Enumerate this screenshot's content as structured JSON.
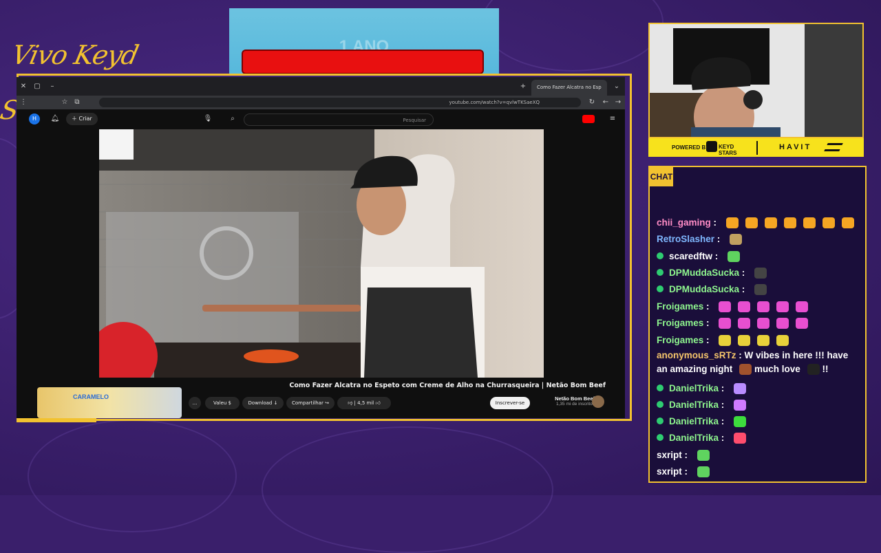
{
  "overlay": {
    "logo_text": "Vivo Keyd Stars",
    "banner_ghost_text": "1 ANO",
    "sponsor_prefix": "POWERED BY",
    "sponsor_brand_1": "KEYD STARS",
    "sponsor_brand_2": "HAVIT",
    "chat_header": "CHAT",
    "colors": {
      "gold": "#f2c230",
      "purple_bg": "#3a1f6b",
      "chat_bg": "#1a0e3a",
      "banner_red": "#e81010"
    }
  },
  "browser": {
    "tab_title": "Como Fazer Alcatra no Esp",
    "url": "youtube.com/watch?v=qvlwTKSaeXQ",
    "youtube": {
      "search_placeholder": "Pesquisar",
      "create_label": "Criar",
      "video_title": "Como Fazer Alcatra no Espeto com Creme de Alho na Churrasqueira | Netão Bom Beef",
      "channel_name": "Netão Bom Beef",
      "subscribers": "1,35 mi de inscritos",
      "subscribe_label": "Inscrever-se",
      "likes": "4,5 mil",
      "share_label": "Compartilhar",
      "download_label": "Download",
      "thanks_label": "Valeu",
      "more_label": "...",
      "recommendation_title": "CARAMELO"
    }
  },
  "chat": {
    "messages": [
      {
        "user": "chii_gaming",
        "color": "#ff8cc6",
        "badge": false,
        "text": "",
        "emotes": [
          "#f5a623",
          "#f5a623",
          "#f5a623",
          "#f5a623",
          "#f5a623",
          "#f5a623",
          "#f5a623"
        ]
      },
      {
        "user": "RetroSlasher",
        "color": "#7fb8ff",
        "badge": false,
        "text": "",
        "emotes": [
          "#c0a060"
        ]
      },
      {
        "user": "scaredftw",
        "color": "#ffffff",
        "badge": true,
        "text": "",
        "emotes": [
          "#5fd35f"
        ]
      },
      {
        "user": "DPMuddaSucka",
        "color": "#8ef58e",
        "badge": true,
        "text": "",
        "emotes": [
          "#444444"
        ]
      },
      {
        "user": "DPMuddaSucka",
        "color": "#8ef58e",
        "badge": true,
        "text": "",
        "emotes": [
          "#444444"
        ]
      },
      {
        "user": "Froigames",
        "color": "#8ef58e",
        "badge": false,
        "text": "",
        "emotes": [
          "#e84fd0",
          "#e84fd0",
          "#e84fd0",
          "#e84fd0",
          "#e84fd0"
        ]
      },
      {
        "user": "Froigames",
        "color": "#8ef58e",
        "badge": false,
        "text": "",
        "emotes": [
          "#e84fd0",
          "#e84fd0",
          "#e84fd0",
          "#e84fd0",
          "#e84fd0"
        ]
      },
      {
        "user": "Froigames",
        "color": "#8ef58e",
        "badge": false,
        "text": "",
        "emotes": [
          "#e8d13a",
          "#e8d13a",
          "#e8d13a",
          "#e8d13a"
        ]
      },
      {
        "user": "anonymous_sRTz",
        "color": "#f5c56b",
        "badge": false,
        "text": "W vibes in here !!! have an amazing night",
        "text2": "much love",
        "text3": "!!",
        "emotes": []
      },
      {
        "user": "DanielTrika",
        "color": "#8ef58e",
        "badge": true,
        "text": "",
        "emotes": [
          "#b98cff"
        ]
      },
      {
        "user": "DanielTrika",
        "color": "#8ef58e",
        "badge": true,
        "text": "",
        "emotes": [
          "#d07aff"
        ]
      },
      {
        "user": "DanielTrika",
        "color": "#8ef58e",
        "badge": true,
        "text": "",
        "emotes": [
          "#3ddc3d"
        ]
      },
      {
        "user": "DanielTrika",
        "color": "#8ef58e",
        "badge": true,
        "text": "",
        "emotes": [
          "#ff4d6d"
        ]
      },
      {
        "user": "sxript",
        "color": "#ffffff",
        "badge": false,
        "text": "",
        "emotes": [
          "#5fd35f"
        ]
      },
      {
        "user": "sxript",
        "color": "#ffffff",
        "badge": false,
        "text": "",
        "emotes": [
          "#5fd35f"
        ]
      }
    ]
  }
}
